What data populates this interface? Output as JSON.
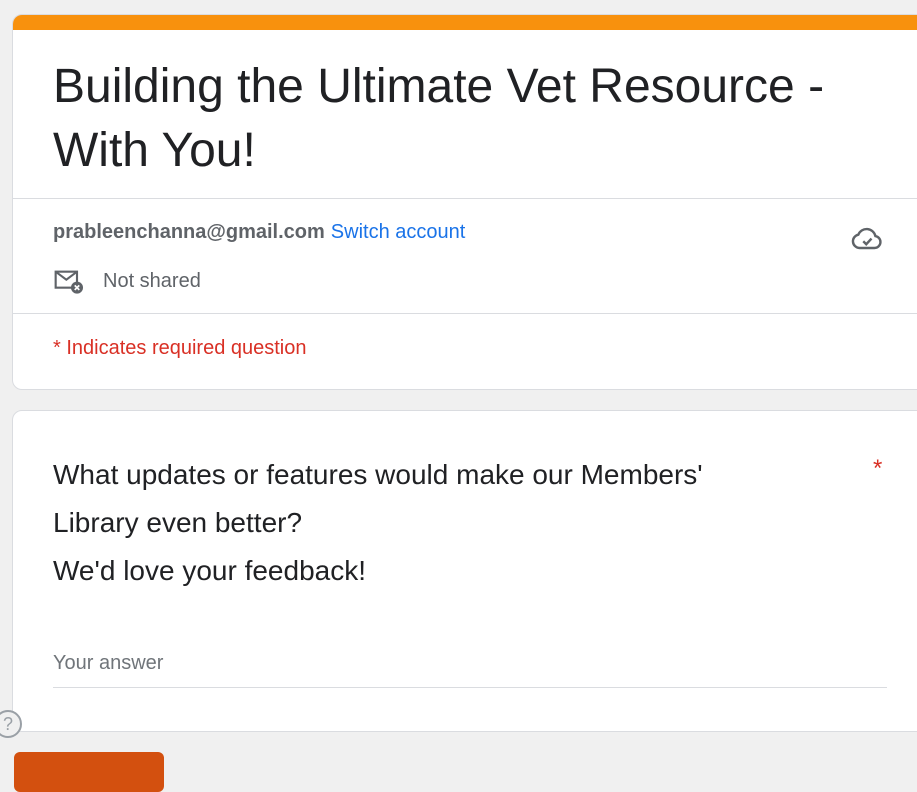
{
  "form": {
    "title": "Building the Ultimate Vet Resource - With You!",
    "accent_color": "#f8910d"
  },
  "account": {
    "email": "prableenchanna@gmail.com",
    "switch_label": "Switch account",
    "sharing_status": "Not shared",
    "cloud_icon": "cloud-check-icon",
    "mail_icon": "mail-not-shared-icon"
  },
  "required_note": "* Indicates required question",
  "question": {
    "lines": [
      "What updates or features would make our Members'",
      "Library even better?",
      "We'd love your feedback!"
    ],
    "required_marker": "*",
    "answer_placeholder": "Your answer"
  },
  "help_icon_glyph": "?",
  "colors": {
    "link": "#1a73e8",
    "required": "#d93025",
    "submit": "#d3500f"
  }
}
